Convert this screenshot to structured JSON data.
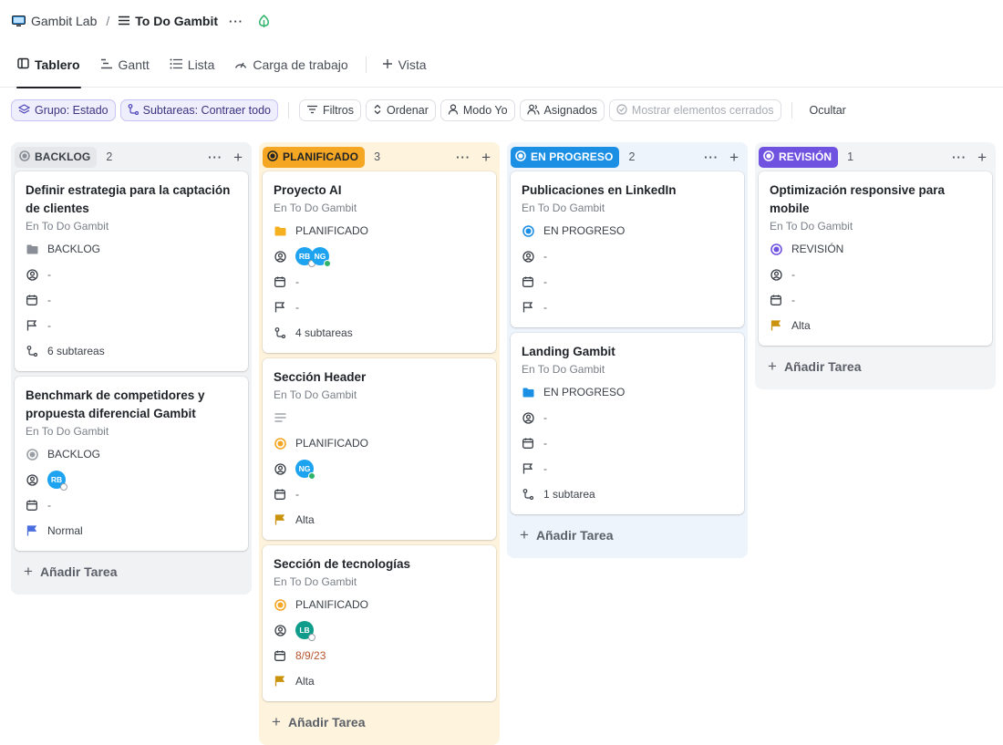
{
  "breadcrumb": {
    "workspace": "Gambit Lab",
    "separator": "/",
    "list": "To Do Gambit",
    "more": "···"
  },
  "tabs": [
    {
      "label": "Tablero",
      "icon": "board-icon",
      "active": true
    },
    {
      "label": "Gantt",
      "icon": "gantt-icon"
    },
    {
      "label": "Lista",
      "icon": "list-icon"
    },
    {
      "label": "Carga de trabajo",
      "icon": "gauge-icon"
    },
    {
      "label": "Vista",
      "icon": "plus-icon"
    }
  ],
  "filters": {
    "group": "Grupo: Estado",
    "subtasks": "Subtareas: Contraer todo",
    "filter": "Filtros",
    "sort": "Ordenar",
    "me_mode": "Modo Yo",
    "assigned": "Asignados",
    "show_closed": "Mostrar elementos cerrados",
    "hide": "Ocultar"
  },
  "colors": {
    "backlog": "#e9eaed",
    "backlog_text": "#3b4048",
    "planned": "#f5a623",
    "planned_bg": "#fef3dd",
    "progress": "#1b8fe3",
    "progress_bg": "#eef4fb",
    "review": "#6f52e0",
    "review_bg": "#f3f4f6",
    "flag_high": "#c9930e",
    "flag_normal": "#4a6ee0",
    "avatar_rb": "#1ea3f0",
    "avatar_ng": "#1ea3f0",
    "avatar_lb": "#0f9c8a"
  },
  "add_task": "Añadir Tarea",
  "dash": "-",
  "columns": [
    {
      "name": "BACKLOG",
      "count": "2",
      "cards": [
        {
          "title": "Definir estrategia para la captación de clientes",
          "location": "En To Do Gambit",
          "status": "BACKLOG",
          "subtasks": "6 subtareas"
        },
        {
          "title": "Benchmark de competidores y propuesta diferencial Gambit",
          "location": "En To Do Gambit",
          "status": "BACKLOG",
          "avatar": "RB",
          "priority": "Normal"
        }
      ]
    },
    {
      "name": "PLANIFICADO",
      "count": "3",
      "cards": [
        {
          "title": "Proyecto AI",
          "location": "En To Do Gambit",
          "status": "PLANIFICADO",
          "avatars": [
            "RB",
            "NG"
          ],
          "subtasks": "4 subtareas"
        },
        {
          "title": "Sección Header",
          "location": "En To Do Gambit",
          "status": "PLANIFICADO",
          "avatar": "NG",
          "priority": "Alta"
        },
        {
          "title": "Sección de tecnologías",
          "location": "En To Do Gambit",
          "status": "PLANIFICADO",
          "avatar": "LB",
          "date": "8/9/23",
          "priority": "Alta"
        }
      ]
    },
    {
      "name": "EN PROGRESO",
      "count": "2",
      "cards": [
        {
          "title": "Publicaciones en LinkedIn",
          "location": "En To Do Gambit",
          "status": "EN PROGRESO"
        },
        {
          "title": "Landing Gambit",
          "location": "En To Do Gambit",
          "status": "EN PROGRESO",
          "subtasks": "1 subtarea"
        }
      ]
    },
    {
      "name": "REVISIÓN",
      "count": "1",
      "cards": [
        {
          "title": "Optimización responsive para mobile",
          "location": "En To Do Gambit",
          "status": "REVISIÓN",
          "priority": "Alta"
        }
      ]
    }
  ]
}
